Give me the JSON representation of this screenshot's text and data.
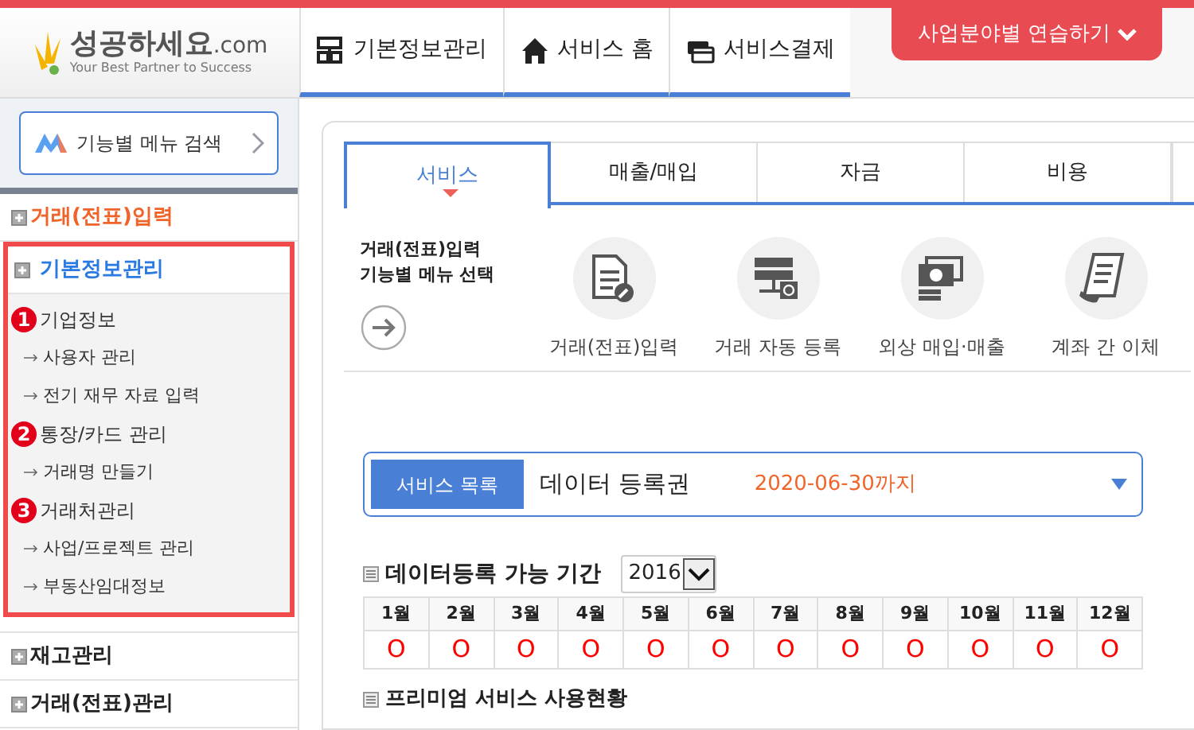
{
  "header": {
    "logo": {
      "name": "성공하세요",
      "suffix": ".com",
      "tagline": "Your Best Partner to Success"
    },
    "nav": [
      {
        "label": "기본정보관리"
      },
      {
        "label": "서비스 홈"
      },
      {
        "label": "서비스결제"
      }
    ],
    "practice_button": "사업분야별 연습하기"
  },
  "sidebar": {
    "search_button": "기능별 메뉴 검색",
    "menu": [
      {
        "label": "거래(전표)입력",
        "highlighted": true,
        "expanded": false,
        "outlined": false
      },
      {
        "label": "기본정보관리",
        "highlighted": false,
        "expanded": true,
        "outlined": true,
        "children": [
          {
            "label": "기업정보",
            "kind": "group",
            "step": "1"
          },
          {
            "label": "사용자 관리",
            "kind": "link"
          },
          {
            "label": "전기 재무 자료 입력",
            "kind": "link"
          },
          {
            "label": "통장/카드 관리",
            "kind": "group",
            "step": "2"
          },
          {
            "label": "거래명 만들기",
            "kind": "link"
          },
          {
            "label": "거래처관리",
            "kind": "group",
            "step": "3"
          },
          {
            "label": "사업/프로젝트 관리",
            "kind": "link"
          },
          {
            "label": "부동산임대정보",
            "kind": "link"
          }
        ]
      },
      {
        "label": "재고관리",
        "highlighted": false,
        "expanded": false,
        "outlined": false
      },
      {
        "label": "거래(전표)관리",
        "highlighted": false,
        "expanded": false,
        "outlined": false
      }
    ]
  },
  "main": {
    "tabs": [
      {
        "label": "서비스",
        "selected": true
      },
      {
        "label": "매출/매입",
        "selected": false
      },
      {
        "label": "자금",
        "selected": false
      },
      {
        "label": "비용",
        "selected": false
      }
    ],
    "feature_intro": [
      "거래(전표)입력",
      "기능별 메뉴 선택"
    ],
    "features": [
      {
        "label": "거래(전표)입력"
      },
      {
        "label": "거래 자동 등록"
      },
      {
        "label": "외상 매입·매출"
      },
      {
        "label": "계좌 간 이체"
      }
    ],
    "service_select": {
      "label": "서비스 목록",
      "value": "데이터 등록권",
      "expiry": "2020-06-30까지"
    },
    "period": {
      "title": "데이터등록 가능 기간",
      "year": "2016",
      "months": [
        {
          "month": "1월",
          "value": "O"
        },
        {
          "month": "2월",
          "value": "O"
        },
        {
          "month": "3월",
          "value": "O"
        },
        {
          "month": "4월",
          "value": "O"
        },
        {
          "month": "5월",
          "value": "O"
        },
        {
          "month": "6월",
          "value": "O"
        },
        {
          "month": "7월",
          "value": "O"
        },
        {
          "month": "8월",
          "value": "O"
        },
        {
          "month": "9월",
          "value": "O"
        },
        {
          "month": "10월",
          "value": "O"
        },
        {
          "month": "11월",
          "value": "O"
        },
        {
          "month": "12월",
          "value": "O"
        }
      ]
    },
    "next_section_title": "프리미엄 서비스 사용현황"
  }
}
